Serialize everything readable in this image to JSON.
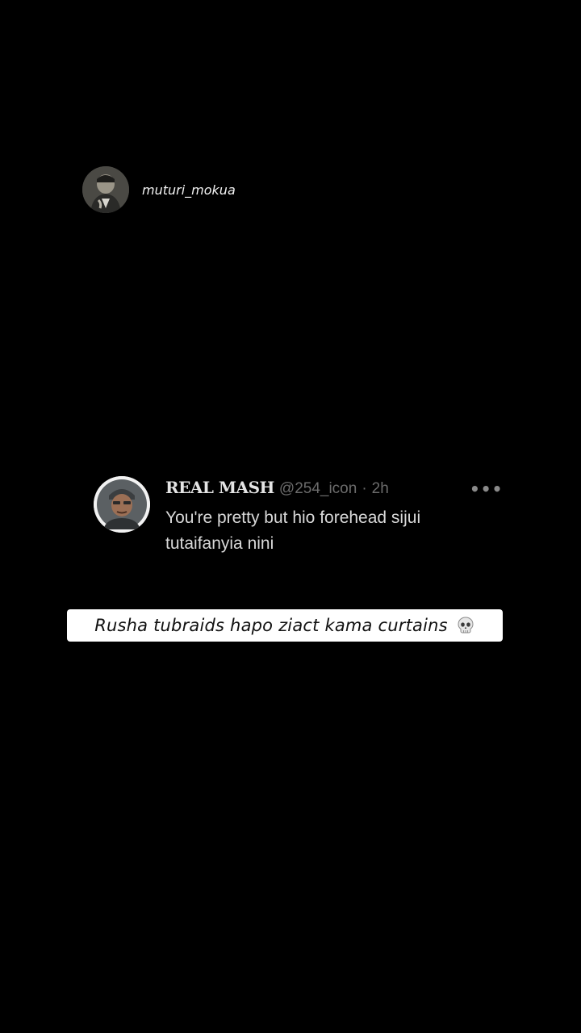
{
  "creator": {
    "username": "muturi_mokua",
    "avatar_icon": "user-avatar-photo"
  },
  "tweet": {
    "display_name": "REAL MASH",
    "handle": "@254_icon",
    "separator": "·",
    "time": "2h",
    "more_icon": "more-dots-icon",
    "more_label": "•••",
    "text": "You're pretty but hio forehead sijui tutaifanyia nini",
    "avatar_icon": "user-avatar-photo"
  },
  "caption": {
    "text": "Rusha tubraids hapo ziact kama curtains",
    "emoji_icon": "skull-icon"
  },
  "colors": {
    "background": "#000000",
    "caption_bg": "#ffffff",
    "handle_gray": "#6c6c6c"
  }
}
